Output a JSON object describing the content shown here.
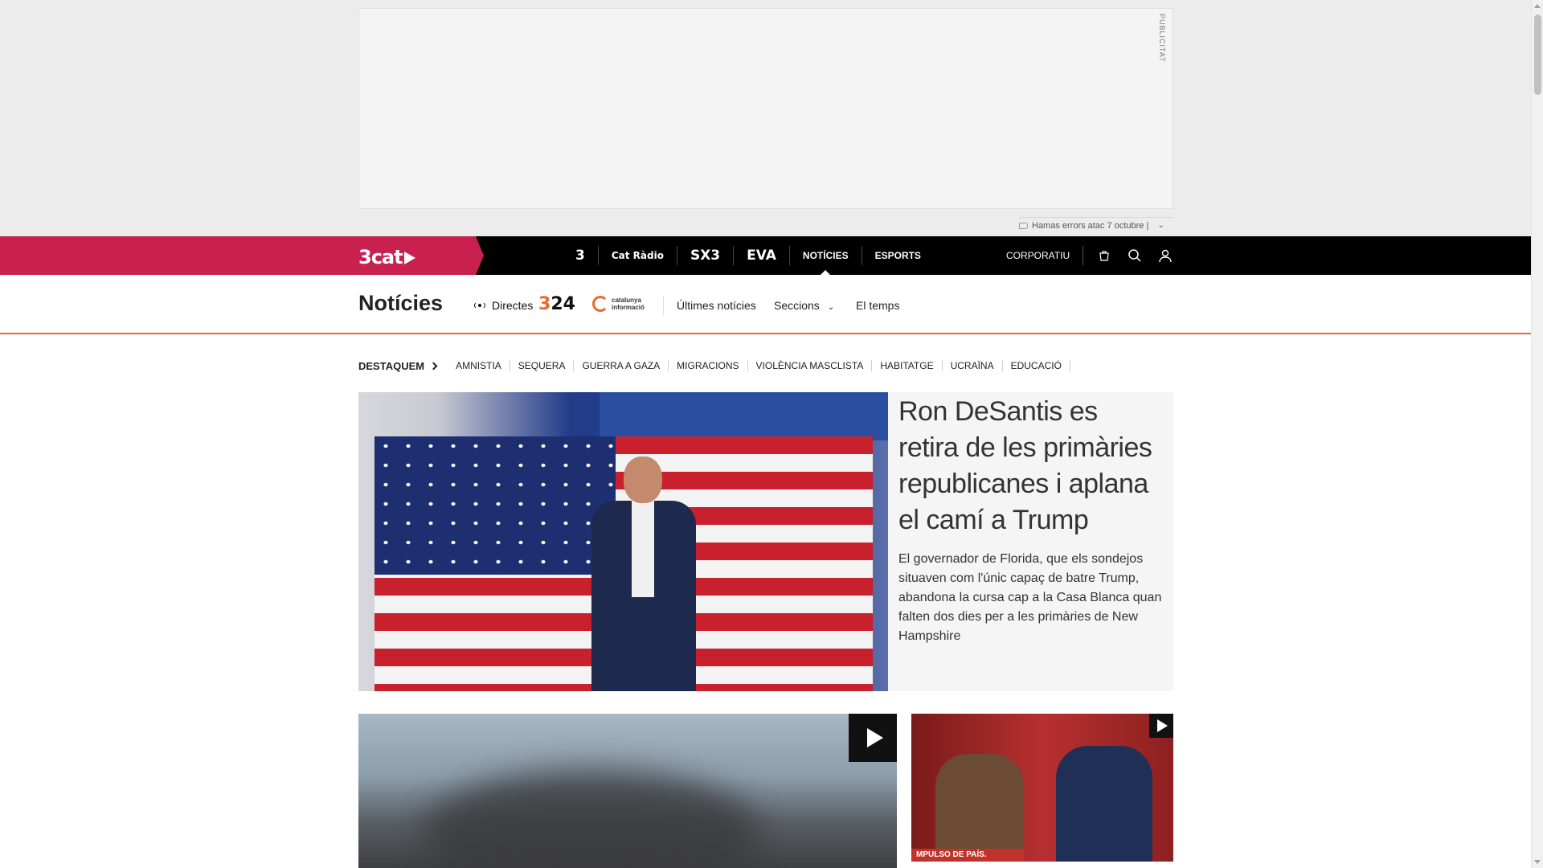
{
  "ad": {
    "label": "PUBLICITAT"
  },
  "alert": {
    "text": "Hamas errors atac 7 octubre |"
  },
  "topbar": {
    "logo": "3cat",
    "channels": [
      {
        "label": "3"
      },
      {
        "label": "Cat Ràdio"
      },
      {
        "label": "SX3"
      },
      {
        "label": "EVA"
      },
      {
        "label": "NOTÍCIES"
      },
      {
        "label": "ESPORTS"
      }
    ],
    "corporatiu": "CORPORATIU",
    "icons": [
      "shopping-bag-icon",
      "search-icon",
      "user-icon"
    ]
  },
  "subnav": {
    "title": "Notícies",
    "directes": "Directes",
    "logo_324": "324",
    "logo_ci": "catalunya informació",
    "ultimes": "Últimes notícies",
    "seccions": "Seccions",
    "temps": "El temps"
  },
  "tags": {
    "destaquem": "DESTAQUEM",
    "items": [
      "AMNISTIA",
      "SEQUERA",
      "GUERRA A GAZA",
      "MIGRACIONS",
      "VIOLÈNCIA MASCLISTA",
      "HABITATGE",
      "UCRAÏNA",
      "EDUCACIÓ"
    ]
  },
  "hero": {
    "title": "Ron DeSantis es retira de les primàries republicanes i aplana el camí a Trump",
    "summary": "El governador de Florida, que els sondejos situaven com l'únic capaç de batre Trump, abandona la cursa cap a la Casa Blanca quan falten dos dies per a les primàries de New Hampshire"
  },
  "cards": {
    "second_slogan": "MPULSO DE PAÍS."
  },
  "colors": {
    "brand": "#c8214f",
    "accent": "#e86a2c",
    "topbar": "#000000"
  }
}
